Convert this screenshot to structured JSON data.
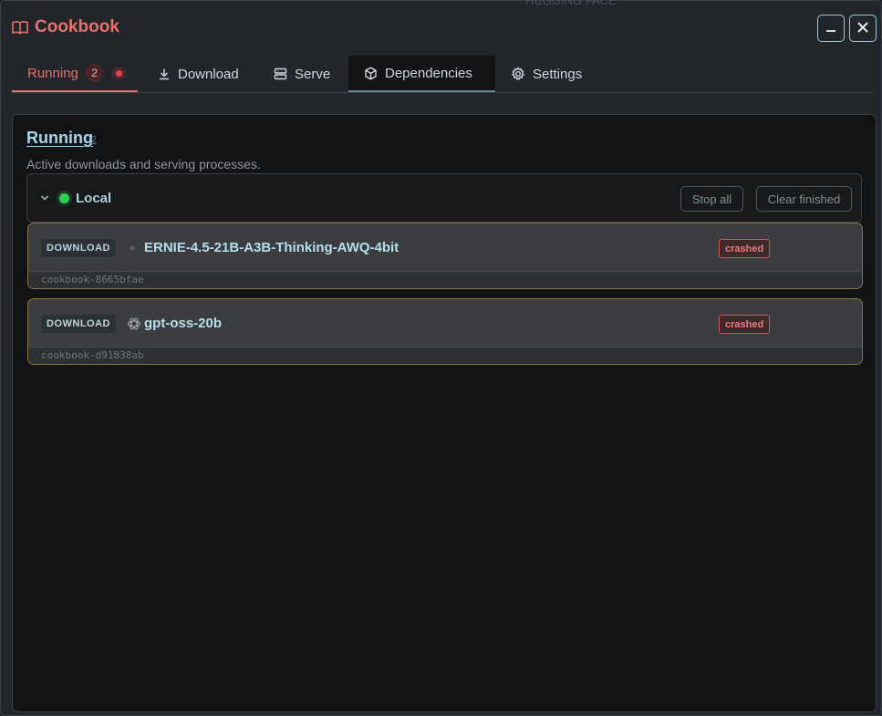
{
  "app": {
    "title": "Cookbook",
    "accent_color": "#e8706d",
    "background_fragment": "HUGGING FACE"
  },
  "window_controls": {
    "minimize_icon": "minimize-icon",
    "close_icon": "close-icon"
  },
  "tabs": [
    {
      "label": "Running",
      "count": "2",
      "icon": "none",
      "active": true
    },
    {
      "label": "Download",
      "icon": "download-icon"
    },
    {
      "label": "Serve",
      "icon": "server-icon"
    },
    {
      "label": "Dependencies",
      "icon": "cube-icon"
    },
    {
      "label": "Settings",
      "icon": "gear-icon"
    }
  ],
  "running": {
    "title": "Running",
    "count": "2",
    "description": "Active downloads and serving processes.",
    "group": {
      "label": "Local",
      "status_color": "#2ecf52",
      "stop_all_label": "Stop all",
      "clear_finished_label": "Clear finished"
    },
    "processes": [
      {
        "kind": "DOWNLOAD",
        "name": "ERNIE-4.5-21B-A3B-Thinking-AWQ-4bit",
        "status": "crashed",
        "id": "cookbook-8665bfae",
        "icon": "dot-icon"
      },
      {
        "kind": "DOWNLOAD",
        "name": "gpt-oss-20b",
        "status": "crashed",
        "id": "cookbook-d91838ab",
        "icon": "openai-icon"
      }
    ]
  }
}
